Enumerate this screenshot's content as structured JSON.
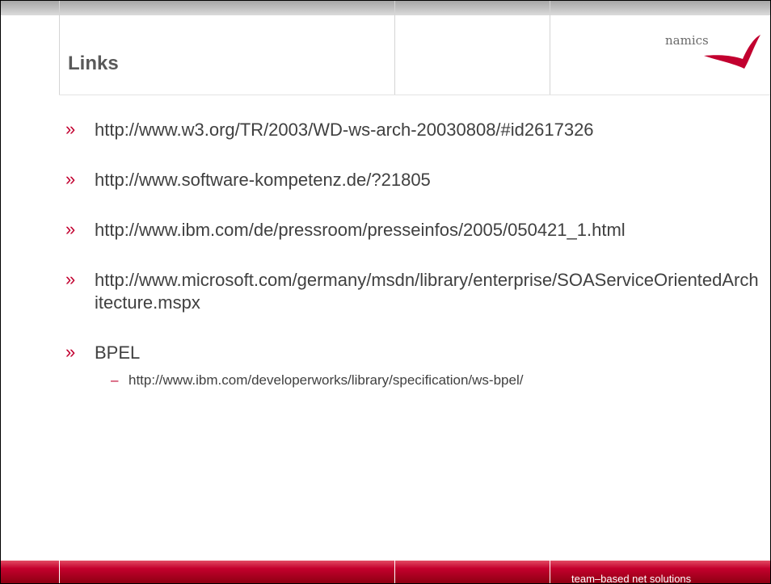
{
  "slide": {
    "title": "Links",
    "logo_text": "namics",
    "tagline": "team–based net solutions",
    "bullet_marker": "»",
    "sub_marker": "–"
  },
  "links": [
    {
      "text": "http://www.w3.org/TR/2003/WD-ws-arch-20030808/#id2617326"
    },
    {
      "text": "http://www.software-kompetenz.de/?21805"
    },
    {
      "text": "http://www.ibm.com/de/pressroom/presseinfos/2005/050421_1.html"
    },
    {
      "text": "http://www.microsoft.com/germany/msdn/library/enterprise/SOAServiceOrientedArchitecture.mspx"
    },
    {
      "text": "BPEL",
      "sub": "http://www.ibm.com/developerworks/library/specification/ws-bpel/"
    }
  ],
  "colors": {
    "accent": "#c2002f",
    "text": "#404040",
    "title": "#595959"
  }
}
